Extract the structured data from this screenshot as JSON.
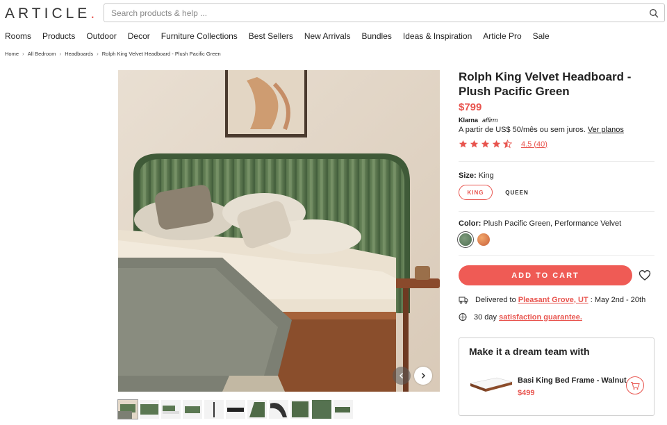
{
  "brand": {
    "logo_text": "ARTICLE",
    "logo_dot": ".",
    "accent": "#e8544e"
  },
  "search": {
    "placeholder": "Search products & help ...",
    "icon": "search-icon"
  },
  "nav": [
    "Rooms",
    "Products",
    "Outdoor",
    "Decor",
    "Furniture Collections",
    "Best Sellers",
    "New Arrivals",
    "Bundles",
    "Ideas & Inspiration",
    "Article Pro",
    "Sale"
  ],
  "breadcrumb": [
    "Home",
    "All Bedroom",
    "Headboards",
    "Rolph King Velvet Headboard - Plush Pacific Green"
  ],
  "product": {
    "title": "Rolph King Velvet Headboard - Plush Pacific Green",
    "price": "$799",
    "pay_klarna": "Klarna",
    "pay_affirm": "affirm",
    "finance_text": "A partir de US$ 50/mês ou sem juros.",
    "finance_link": "Ver planos",
    "rating": 4.5,
    "rating_text": "4.5 (40)",
    "size_label": "Size:",
    "size_value": "King",
    "sizes": [
      "KING",
      "QUEEN"
    ],
    "selected_size": "KING",
    "color_label": "Color:",
    "color_value": "Plush Pacific Green, Performance Velvet",
    "swatches": [
      {
        "name": "Plush Pacific Green",
        "color": "#5f7f5f",
        "selected": true
      },
      {
        "name": "Orange",
        "color": "#e07f4c",
        "selected": false
      }
    ],
    "add_to_cart": "ADD TO CART",
    "delivery_prefix": "Delivered to",
    "delivery_location": "Pleasant Grove, UT",
    "delivery_dates": ": May 2nd - 20th",
    "guarantee_prefix": "30 day",
    "guarantee_link": "satisfaction guarantee."
  },
  "gallery": {
    "thumbnail_count": 11,
    "active_index": 0
  },
  "dream_team": {
    "heading": "Make it a dream team with",
    "item_name": "Basi King Bed Frame - Walnut",
    "item_price": "$499"
  }
}
